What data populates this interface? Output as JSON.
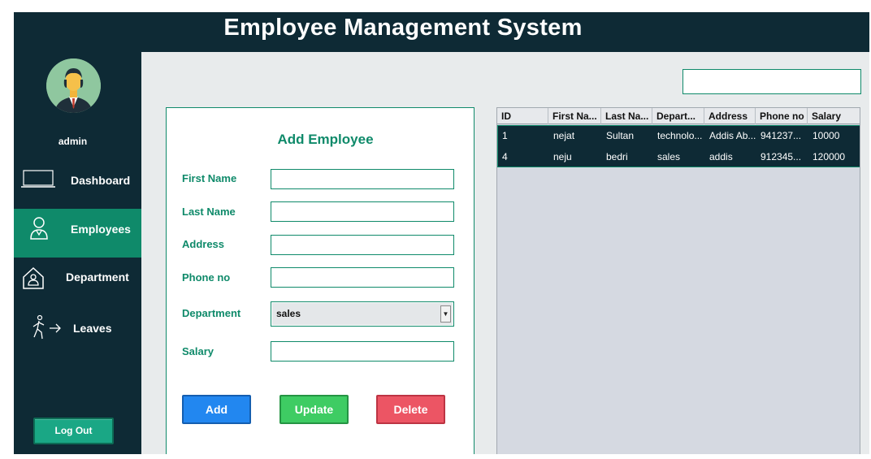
{
  "app": {
    "title": "Employee Management System"
  },
  "sidebar": {
    "user": "admin",
    "items": [
      {
        "label": "Dashboard",
        "icon": "laptop-icon"
      },
      {
        "label": "Employees",
        "icon": "employee-icon"
      },
      {
        "label": "Department",
        "icon": "building-icon"
      },
      {
        "label": "Leaves",
        "icon": "walking-exit-icon"
      }
    ],
    "active": "Employees",
    "logout_label": "Log Out"
  },
  "search": {
    "value": "",
    "placeholder": ""
  },
  "form": {
    "title": "Add Employee",
    "fields": {
      "first_name": {
        "label": "First Name",
        "value": ""
      },
      "last_name": {
        "label": "Last Name",
        "value": ""
      },
      "address": {
        "label": "Address",
        "value": ""
      },
      "phone": {
        "label": "Phone no",
        "value": ""
      },
      "department": {
        "label": "Department",
        "value": "sales"
      },
      "salary": {
        "label": "Salary",
        "value": ""
      }
    },
    "buttons": {
      "add": "Add",
      "update": "Update",
      "delete": "Delete"
    }
  },
  "table": {
    "columns": [
      "ID",
      "First Na...",
      "Last Na...",
      "Depart...",
      "Address",
      "Phone no",
      "Salary"
    ],
    "rows": [
      [
        "1",
        "nejat",
        "Sultan",
        "technolo...",
        "Addis Ab...",
        "941237...",
        "10000"
      ],
      [
        "4",
        "neju",
        "bedri",
        "sales",
        "addis",
        "912345...",
        "120000"
      ]
    ]
  },
  "colors": {
    "navy": "#0e2a35",
    "accent_green": "#0f8a6a",
    "add_blue": "#2287f0",
    "update_green": "#3ecc63",
    "delete_red": "#ec5564"
  }
}
